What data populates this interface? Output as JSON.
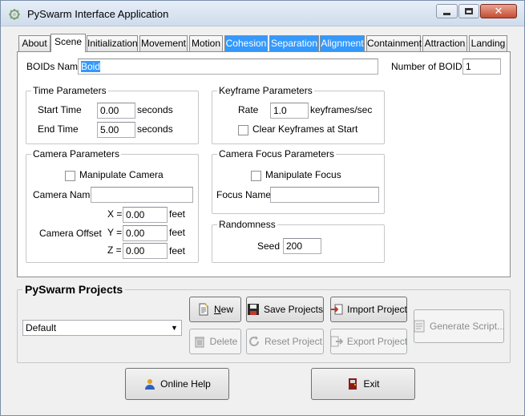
{
  "window": {
    "title": "PySwarm Interface Application",
    "icon": "swarm-gear-icon",
    "minimize": "minimize-icon",
    "maximize": "maximize-icon",
    "close": "close-icon"
  },
  "tabs": [
    {
      "label": "About"
    },
    {
      "label": "Scene",
      "selected": true
    },
    {
      "label": "Initialization"
    },
    {
      "label": "Movement"
    },
    {
      "label": "Motion"
    },
    {
      "label": "Cohesion",
      "highlight": "#3399ff"
    },
    {
      "label": "Separation",
      "highlight": "#3399ff"
    },
    {
      "label": "Alignment",
      "highlight": "#3399ff"
    },
    {
      "label": "Containment"
    },
    {
      "label": "Attraction"
    },
    {
      "label": "Landing"
    }
  ],
  "scene": {
    "boids_name_label": "BOIDs Name",
    "boids_name_value": "Boid",
    "num_boids_label": "Number of BOIDs",
    "num_boids_value": "1",
    "time_params": {
      "title": "Time Parameters",
      "start_label": "Start Time",
      "start_value": "0.00",
      "start_unit": "seconds",
      "end_label": "End Time",
      "end_value": "5.00",
      "end_unit": "seconds"
    },
    "keyframe_params": {
      "title": "Keyframe Parameters",
      "rate_label": "Rate",
      "rate_value": "1.0",
      "rate_unit": "keyframes/sec",
      "clear_label": "Clear Keyframes at Start",
      "clear_checked": false
    },
    "camera_params": {
      "title": "Camera Parameters",
      "manipulate_label": "Manipulate Camera",
      "manipulate_checked": false,
      "name_label": "Camera Name",
      "name_value": "",
      "offset_label": "Camera Offset",
      "x_label": "X =",
      "x_value": "0.00",
      "y_label": "Y =",
      "y_value": "0.00",
      "z_label": "Z =",
      "z_value": "0.00",
      "unit": "feet"
    },
    "focus_params": {
      "title": "Camera Focus Parameters",
      "manipulate_label": "Manipulate Focus",
      "manipulate_checked": false,
      "name_label": "Focus Name",
      "name_value": ""
    },
    "randomness": {
      "title": "Randomness",
      "seed_label": "Seed",
      "seed_value": "200"
    }
  },
  "projects": {
    "title": "PySwarm Projects",
    "selected_project": "Default",
    "new_label": "New",
    "new_accel": "N",
    "new_rest": "ew",
    "save_label": "Save Projects",
    "import_label": "Import Project",
    "delete_label": "Delete",
    "reset_label": "Reset Project",
    "export_label": "Export Project",
    "generate_label": "Generate Script..."
  },
  "footer": {
    "help_label": "Online Help",
    "exit_label": "Exit"
  }
}
